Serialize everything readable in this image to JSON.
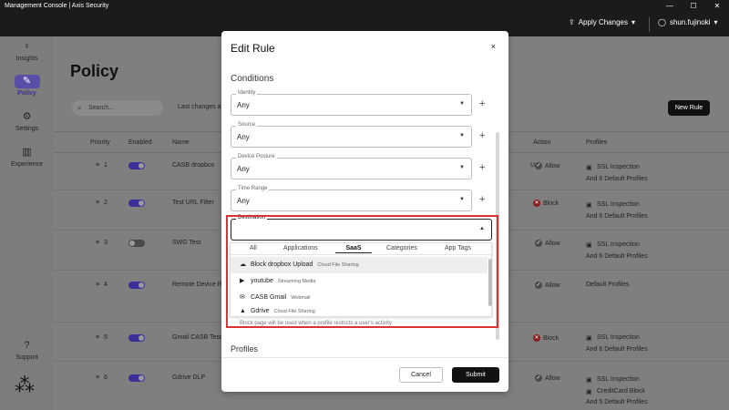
{
  "window": {
    "title": "Management Console | Axis Security",
    "controls": [
      "—",
      "☐",
      "✕"
    ]
  },
  "topbar": {
    "apply_label": "Apply Changes",
    "username": "shun.fujinoki"
  },
  "sidebar": {
    "items": [
      {
        "label": "Insights",
        "icon": "lightbulb-icon"
      },
      {
        "label": "Policy",
        "icon": "policy-icon"
      },
      {
        "label": "Settings",
        "icon": "gear-icon"
      },
      {
        "label": "Experience",
        "icon": "bar-chart-icon"
      },
      {
        "label": "Support",
        "icon": "question-icon"
      }
    ]
  },
  "main": {
    "title": "Policy",
    "search_placeholder": "Search...",
    "last_changes": "Last changes ap",
    "new_rule": "New Rule",
    "columns": {
      "priority": "Priority",
      "enabled": "Enabled",
      "name": "Name",
      "action": "Action",
      "profiles": "Profiles"
    },
    "rows": [
      {
        "priority": "1",
        "enabled": true,
        "name": "CASB dropbox",
        "action": "Allow",
        "profile1": "SSL Inspection",
        "profile2": "And 6 Default Profiles",
        "extra": "U,"
      },
      {
        "priority": "2",
        "enabled": true,
        "name": "Test URL Filter",
        "action": "Block",
        "profile1": "SSL Inspection",
        "profile2": "And 6 Default Profiles",
        "extra": ""
      },
      {
        "priority": "3",
        "enabled": false,
        "name": "SWG Test",
        "action": "Allow",
        "profile1": "SSL Inspection",
        "profile2": "And 6 Default Profiles",
        "extra": ""
      },
      {
        "priority": "4",
        "enabled": true,
        "name": "Remote Device R",
        "action": "Allow",
        "profile1": "Default Profiles",
        "profile2": "",
        "extra": ""
      },
      {
        "priority": "5",
        "enabled": true,
        "name": "Gmail CASB Test",
        "action": "Block",
        "profile1": "SSL Inspection",
        "profile2": "And 6 Default Profiles",
        "extra": ""
      },
      {
        "priority": "6",
        "enabled": true,
        "name": "Gdrive DLP",
        "action": "Allow",
        "profile1": "SSL Inspection",
        "profile2": "CreditCard Block",
        "profile3": "And 5 Default Profiles",
        "extra": ""
      }
    ]
  },
  "modal": {
    "title": "Edit Rule",
    "close": "×",
    "conditions_title": "Conditions",
    "fields": [
      {
        "label": "Identity",
        "value": "Any"
      },
      {
        "label": "Source",
        "value": "Any"
      },
      {
        "label": "Device Posture",
        "value": "Any"
      },
      {
        "label": "Time Range",
        "value": "Any"
      }
    ],
    "destination": {
      "label": "Destination",
      "tabs": [
        "All",
        "Applications",
        "SaaS",
        "Categories",
        "App Tags"
      ],
      "active_tab": "SaaS",
      "items": [
        {
          "name": "Block dropbox Upload",
          "category": "Cloud File Sharing",
          "icon": "cloud-icon"
        },
        {
          "name": "youtube",
          "category": "Streaming Media",
          "icon": "play-icon"
        },
        {
          "name": "CASB Gmail",
          "category": "Webmail",
          "icon": "mail-icon"
        },
        {
          "name": "Gdrive",
          "category": "Cloud File Sharing",
          "icon": "drive-icon"
        }
      ]
    },
    "hint": "Block page will be used when a profile restricts a user's activity",
    "profiles_label": "Profiles",
    "cancel": "Cancel",
    "submit": "Submit"
  }
}
